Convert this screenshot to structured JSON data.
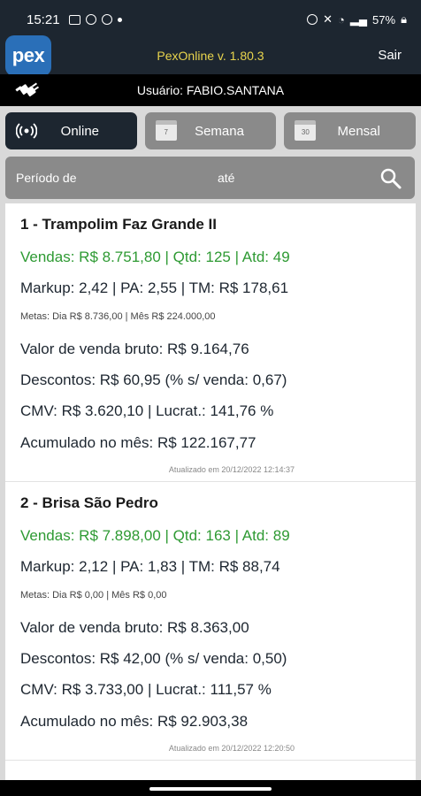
{
  "status_bar": {
    "time": "15:21",
    "battery": "57%"
  },
  "header": {
    "logo_text": "pex",
    "app_title": "PexOnline v. 1.80.3",
    "exit_label": "Sair"
  },
  "user_bar": {
    "user_text": "Usuário: FABIO.SANTANA"
  },
  "tabs": [
    {
      "label": "Online",
      "icon": "broadcast-icon",
      "active": true
    },
    {
      "label": "Semana",
      "icon": "calendar-icon",
      "icon_text": "7"
    },
    {
      "label": "Mensal",
      "icon": "calendar-icon",
      "icon_text": "30"
    }
  ],
  "period": {
    "from_label": "Período de",
    "to_label": "até",
    "search_icon": "search-icon"
  },
  "stores": [
    {
      "title": "1 - Trampolim Faz Grande II",
      "sales": "Vendas: R$ 8.751,80 | Qtd: 125 | Atd: 49",
      "markup": "Markup: 2,42 | PA: 2,55 | TM: R$ 178,61",
      "goals": "Metas: Dia R$ 8.736,00 | Mês R$ 224.000,00",
      "gross": "Valor de venda bruto: R$ 9.164,76",
      "discounts": "Descontos: R$ 60,95 (% s/ venda: 0,67)",
      "cmv": "CMV: R$ 3.620,10 | Lucrat.: 141,76 %",
      "accumulated": "Acumulado no mês: R$ 122.167,77",
      "updated": "Atualizado em 20/12/2022 12:14:37"
    },
    {
      "title": "2 - Brisa São Pedro",
      "sales": "Vendas: R$ 7.898,00 | Qtd: 163 | Atd: 89",
      "markup": "Markup: 2,12 | PA: 1,83 | TM: R$ 88,74",
      "goals": "Metas: Dia R$ 0,00 | Mês R$ 0,00",
      "gross": "Valor de venda bruto: R$ 8.363,00",
      "discounts": "Descontos: R$ 42,00 (% s/ venda: 0,50)",
      "cmv": "CMV: R$ 3.733,00 | Lucrat.: 111,57 %",
      "accumulated": "Acumulado no mês: R$ 92.903,38",
      "updated": "Atualizado em 20/12/2022 12:20:50"
    }
  ],
  "colors": {
    "header_bg": "#1d2630",
    "sales_green": "#2e9a33",
    "title_yellow": "#e8d44d",
    "tab_gray": "#8a8a8a"
  }
}
